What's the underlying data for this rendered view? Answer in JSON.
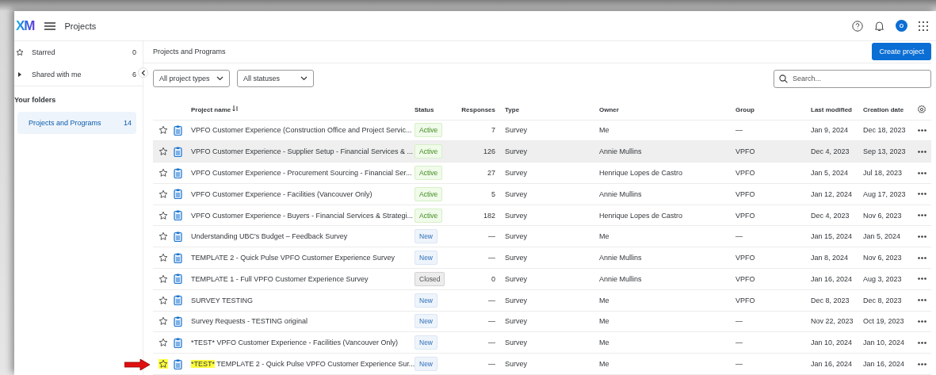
{
  "topbar": {
    "logo": "XM",
    "title": "Projects",
    "avatar": "O"
  },
  "sidebar": {
    "items": [
      {
        "label": "Starred",
        "count": "0",
        "kind": "star",
        "selected": false
      },
      {
        "label": "Shared with me",
        "count": "6",
        "kind": "caret",
        "selected": false
      }
    ],
    "folders_heading": "Your folders",
    "folders": [
      {
        "label": "Projects and Programs",
        "count": "14",
        "selected": true
      }
    ]
  },
  "main": {
    "heading": "Projects and Programs",
    "create_button": "Create project",
    "filters": [
      {
        "label": "All project types"
      },
      {
        "label": "All statuses"
      }
    ],
    "search": {
      "placeholder": "Search..."
    }
  },
  "table": {
    "columns": [
      "Project name",
      "Status",
      "Responses",
      "Type",
      "Owner",
      "Group",
      "Last modified",
      "Creation date"
    ],
    "rows": [
      {
        "name": "VPFO Customer Experience (Construction Office and Project Servic...",
        "status": "Active",
        "responses": "7",
        "type": "Survey",
        "owner": "Me",
        "group": "—",
        "modified": "Jan 9, 2024",
        "created": "Dec 18, 2023",
        "hovered": false,
        "highlighted": false
      },
      {
        "name": "VPFO Customer Experience - Supplier Setup - Financial Services & ...",
        "status": "Active",
        "responses": "126",
        "type": "Survey",
        "owner": "Annie Mullins",
        "group": "VPFO",
        "modified": "Dec 4, 2023",
        "created": "Sep 13, 2023",
        "hovered": true,
        "highlighted": false
      },
      {
        "name": "VPFO Customer Experience - Procurement Sourcing - Financial Ser...",
        "status": "Active",
        "responses": "27",
        "type": "Survey",
        "owner": "Henrique Lopes de Castro",
        "group": "VPFO",
        "modified": "Jan 5, 2024",
        "created": "Jul 18, 2023",
        "hovered": false,
        "highlighted": false
      },
      {
        "name": "VPFO Customer Experience - Facilities (Vancouver Only)",
        "status": "Active",
        "responses": "5",
        "type": "Survey",
        "owner": "Annie Mullins",
        "group": "VPFO",
        "modified": "Jan 12, 2024",
        "created": "Aug 17, 2023",
        "hovered": false,
        "highlighted": false
      },
      {
        "name": "VPFO Customer Experience - Buyers - Financial Services & Strategi...",
        "status": "Active",
        "responses": "182",
        "type": "Survey",
        "owner": "Henrique Lopes de Castro",
        "group": "VPFO",
        "modified": "Dec 4, 2023",
        "created": "Nov 6, 2023",
        "hovered": false,
        "highlighted": false
      },
      {
        "name": "Understanding UBC's Budget – Feedback Survey",
        "status": "New",
        "responses": "—",
        "type": "Survey",
        "owner": "Me",
        "group": "—",
        "modified": "Jan 15, 2024",
        "created": "Jan 5, 2024",
        "hovered": false,
        "highlighted": false
      },
      {
        "name": "TEMPLATE 2 - Quick Pulse VPFO Customer Experience Survey",
        "status": "New",
        "responses": "—",
        "type": "Survey",
        "owner": "Annie Mullins",
        "group": "VPFO",
        "modified": "Jan 8, 2024",
        "created": "Nov 6, 2023",
        "hovered": false,
        "highlighted": false
      },
      {
        "name": "TEMPLATE 1 - Full VPFO Customer Experience Survey",
        "status": "Closed",
        "responses": "0",
        "type": "Survey",
        "owner": "Annie Mullins",
        "group": "VPFO",
        "modified": "Jan 16, 2024",
        "created": "Aug 3, 2023",
        "hovered": false,
        "highlighted": false
      },
      {
        "name": "SURVEY TESTING",
        "status": "New",
        "responses": "—",
        "type": "Survey",
        "owner": "Me",
        "group": "VPFO",
        "modified": "Dec 8, 2023",
        "created": "Dec 8, 2023",
        "hovered": false,
        "highlighted": false
      },
      {
        "name": "Survey Requests - TESTING original",
        "status": "New",
        "responses": "—",
        "type": "Survey",
        "owner": "Me",
        "group": "—",
        "modified": "Nov 22, 2023",
        "created": "Oct 19, 2023",
        "hovered": false,
        "highlighted": false
      },
      {
        "name": "*TEST* VPFO Customer Experience - Facilities (Vancouver Only)",
        "status": "New",
        "responses": "—",
        "type": "Survey",
        "owner": "Me",
        "group": "—",
        "modified": "Jan 10, 2024",
        "created": "Jan 10, 2024",
        "hovered": false,
        "highlighted": false
      },
      {
        "name_highlight": "*TEST*",
        "name": "TEMPLATE 2 - Quick Pulse VPFO Customer Experience Sur...",
        "status": "New",
        "responses": "—",
        "type": "Survey",
        "owner": "Me",
        "group": "—",
        "modified": "Jan 16, 2024",
        "created": "Jan 16, 2024",
        "hovered": false,
        "highlighted": true,
        "arrow": true
      }
    ]
  }
}
